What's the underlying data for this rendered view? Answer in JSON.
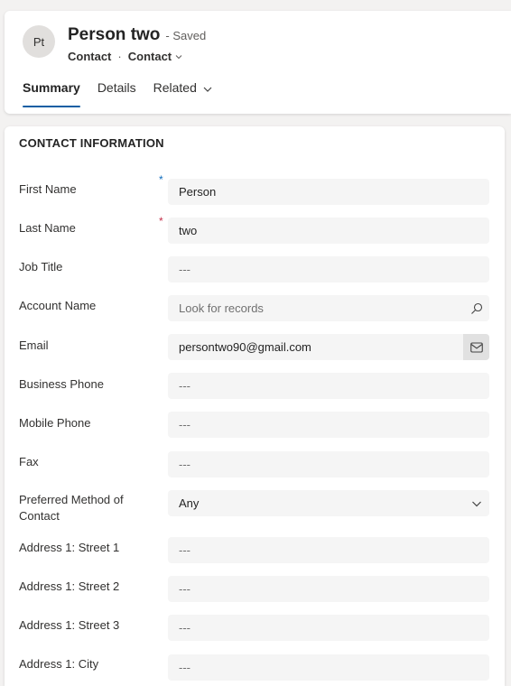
{
  "record": {
    "initials": "Pt",
    "name": "Person two",
    "status": "- Saved",
    "entity": "Contact",
    "form": "Contact"
  },
  "tabs": [
    {
      "label": "Summary",
      "active": true
    },
    {
      "label": "Details",
      "active": false
    },
    {
      "label": "Related",
      "active": false
    }
  ],
  "section": {
    "title": "CONTACT INFORMATION",
    "fields": {
      "first_name": {
        "label": "First Name",
        "value": "Person",
        "required_mark": "*"
      },
      "last_name": {
        "label": "Last Name",
        "value": "two",
        "required_mark": "*"
      },
      "job_title": {
        "label": "Job Title",
        "value": "---"
      },
      "account_name": {
        "label": "Account Name",
        "placeholder": "Look for records"
      },
      "email": {
        "label": "Email",
        "value": "persontwo90@gmail.com"
      },
      "business_phone": {
        "label": "Business Phone",
        "value": "---"
      },
      "mobile_phone": {
        "label": "Mobile Phone",
        "value": "---"
      },
      "fax": {
        "label": "Fax",
        "value": "---"
      },
      "preferred_contact": {
        "label": "Preferred Method of Contact",
        "value": "Any"
      },
      "street1": {
        "label": "Address 1: Street 1",
        "value": "---"
      },
      "street2": {
        "label": "Address 1: Street 2",
        "value": "---"
      },
      "street3": {
        "label": "Address 1: Street 3",
        "value": "---"
      },
      "city": {
        "label": "Address 1: City",
        "value": "---"
      }
    }
  },
  "icons": {
    "search": "search-icon",
    "mail": "mail-icon",
    "chevron": "chevron-down-icon"
  },
  "colors": {
    "accent": "#115ea3",
    "required_blue": "#0f6cbd",
    "required_red": "#c4314b",
    "input_bg": "#f5f5f5"
  }
}
